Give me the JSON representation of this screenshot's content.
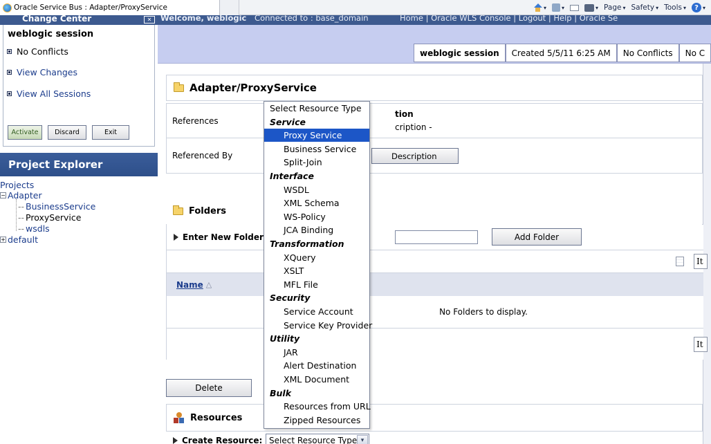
{
  "browser": {
    "tab_title": "Oracle Service Bus : Adapter/ProxyService",
    "commands": {
      "page": "Page",
      "safety": "Safety",
      "tools": "Tools"
    }
  },
  "change_center": {
    "title": "Change Center",
    "session_name": "weblogic session",
    "status": "No Conflicts",
    "links": [
      "View Changes",
      "View All Sessions"
    ],
    "buttons": {
      "activate": "Activate",
      "discard": "Discard",
      "exit": "Exit"
    }
  },
  "project_explorer": {
    "title": "Project Explorer",
    "root": "Projects",
    "adapter": "Adapter",
    "children": [
      "BusinessService",
      "ProxyService",
      "wsdls"
    ],
    "default": "default"
  },
  "top_bar": {
    "welcome": "Welcome, weblogic",
    "connected": "Connected to : base_domain",
    "links": "Home | Oracle WLS Console | Logout | Help | Oracle Se"
  },
  "session_bar": {
    "name": "weblogic session",
    "created": "Created 5/5/11 6:25 AM",
    "conflicts": "No Conflicts",
    "truncated": "No C"
  },
  "main": {
    "title": "Adapter/ProxyService",
    "references_label": "References",
    "referenced_by_label": "Referenced By",
    "description_head": "tion",
    "description_text": "cription -",
    "edit_description": "Description",
    "folders_title": "Folders",
    "enter_new_folder": "Enter New Folder N",
    "add_folder": "Add Folder",
    "items_per_page": "It",
    "name_col": "Name",
    "empty": "No Folders to display.",
    "delete": "Delete",
    "resources_title": "Resources",
    "create_resource": "Create Resource:",
    "create_value": "Select Resource Type"
  },
  "dropdown": {
    "items": [
      {
        "kind": "head",
        "label": "Select Resource Type"
      },
      {
        "kind": "group",
        "label": "Service"
      },
      {
        "kind": "opt",
        "label": "Proxy Service",
        "selected": true
      },
      {
        "kind": "opt",
        "label": "Business Service"
      },
      {
        "kind": "opt",
        "label": "Split-Join"
      },
      {
        "kind": "group",
        "label": "Interface"
      },
      {
        "kind": "opt",
        "label": "WSDL"
      },
      {
        "kind": "opt",
        "label": "XML Schema"
      },
      {
        "kind": "opt",
        "label": "WS-Policy"
      },
      {
        "kind": "opt",
        "label": "JCA Binding"
      },
      {
        "kind": "group",
        "label": "Transformation"
      },
      {
        "kind": "opt",
        "label": "XQuery"
      },
      {
        "kind": "opt",
        "label": "XSLT"
      },
      {
        "kind": "opt",
        "label": "MFL File"
      },
      {
        "kind": "group",
        "label": "Security"
      },
      {
        "kind": "opt",
        "label": "Service Account"
      },
      {
        "kind": "opt",
        "label": "Service Key Provider"
      },
      {
        "kind": "group",
        "label": "Utility"
      },
      {
        "kind": "opt",
        "label": "JAR"
      },
      {
        "kind": "opt",
        "label": "Alert Destination"
      },
      {
        "kind": "opt",
        "label": "XML Document"
      },
      {
        "kind": "group",
        "label": "Bulk"
      },
      {
        "kind": "opt",
        "label": "Resources from URL"
      },
      {
        "kind": "opt",
        "label": "Zipped Resources"
      }
    ]
  },
  "colors": {
    "header_blue": "#3d5a8f",
    "session_bar": "#c6cdf0",
    "link": "#1b3c8c",
    "selection": "#1c56c7"
  }
}
